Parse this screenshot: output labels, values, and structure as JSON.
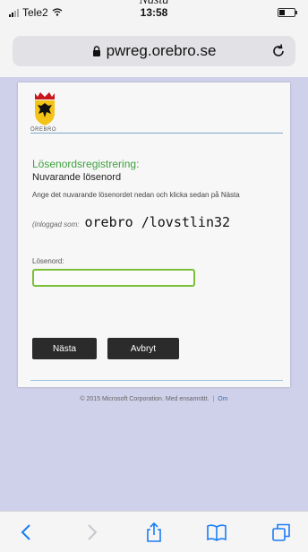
{
  "page_peek_title": "Nästa",
  "status_bar": {
    "carrier": "Tele2",
    "time": "13:58"
  },
  "browser": {
    "url": "pwreg.orebro.se"
  },
  "logo": {
    "caption": "ÖREBRO"
  },
  "form": {
    "heading": "Lösenordsregistrering:",
    "subheading": "Nuvarande lösenord",
    "instruction": "Ange det nuvarande lösenordet nedan och klicka sedan på Nästa",
    "logged_in_label": "(inloggad som:",
    "logged_in_user": "orebro /lovstlin32",
    "password_label": "Lösenord:",
    "password_value": "",
    "next_label": "Nästa",
    "cancel_label": "Avbryt"
  },
  "footer": {
    "copyright": "© 2015 Microsoft Corporation. Med ensamrätt.",
    "separator": "|",
    "link": "Om"
  },
  "colors": {
    "heading_green": "#3fa13f",
    "input_border_green": "#7cc03a",
    "button_dark": "#2b2b2b",
    "ios_blue": "#1a7cf5",
    "page_background": "#cfd0ea"
  },
  "toolbar": {
    "icons": [
      "back-icon",
      "forward-icon",
      "share-icon",
      "bookmarks-icon",
      "tabs-icon"
    ]
  }
}
